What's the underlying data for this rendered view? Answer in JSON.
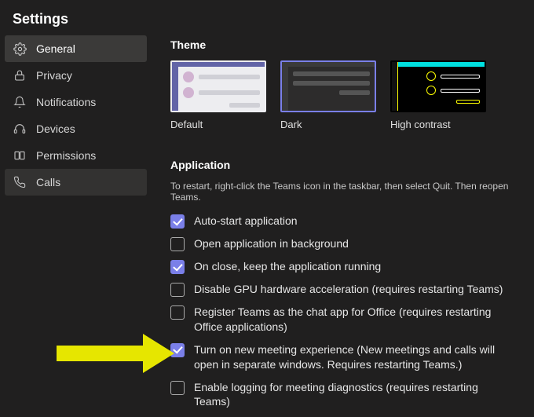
{
  "title": "Settings",
  "sidebar": {
    "items": [
      {
        "label": "General"
      },
      {
        "label": "Privacy"
      },
      {
        "label": "Notifications"
      },
      {
        "label": "Devices"
      },
      {
        "label": "Permissions"
      },
      {
        "label": "Calls"
      }
    ]
  },
  "theme": {
    "heading": "Theme",
    "options": [
      {
        "label": "Default"
      },
      {
        "label": "Dark"
      },
      {
        "label": "High contrast"
      }
    ]
  },
  "application": {
    "heading": "Application",
    "hint": "To restart, right-click the Teams icon in the taskbar, then select Quit. Then reopen Teams.",
    "options": [
      {
        "checked": true,
        "label": "Auto-start application"
      },
      {
        "checked": false,
        "label": "Open application in background"
      },
      {
        "checked": true,
        "label": "On close, keep the application running"
      },
      {
        "checked": false,
        "label": "Disable GPU hardware acceleration (requires restarting Teams)"
      },
      {
        "checked": false,
        "label": "Register Teams as the chat app for Office (requires restarting Office applications)"
      },
      {
        "checked": true,
        "label": "Turn on new meeting experience (New meetings and calls will open in separate windows. Requires restarting Teams.)"
      },
      {
        "checked": false,
        "label": "Enable logging for meeting diagnostics (requires restarting Teams)"
      }
    ]
  }
}
